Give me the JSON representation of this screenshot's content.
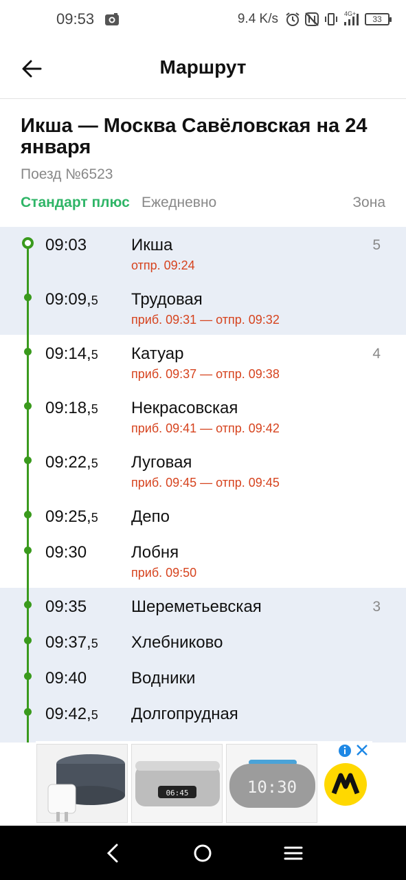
{
  "status_bar": {
    "time": "09:53",
    "net_speed": "9.4 K/s",
    "network": "4G+",
    "battery": "33",
    "icons": [
      "camera-icon",
      "alarm-icon",
      "nfc-off-icon",
      "vibrate-icon",
      "signal-icon",
      "battery-icon"
    ]
  },
  "app_bar": {
    "title": "Маршрут",
    "back_icon": "arrow-left-icon"
  },
  "route": {
    "title": "Икша — Москва Савёловская на 24 января",
    "train": "Поезд №6523",
    "type": "Стандарт плюс",
    "days": "Ежедневно",
    "zone_header": "Зона"
  },
  "colors": {
    "accent_green": "#2fb567",
    "line_green": "#3a9a1d",
    "delay_red": "#d6431e",
    "band_blue": "#e9eef6"
  },
  "stops": [
    {
      "time": "09:03",
      "half": "",
      "name": "Икша",
      "sub": "отпр. 09:24",
      "zone": "5"
    },
    {
      "time": "09:09,",
      "half": "5",
      "name": "Трудовая",
      "sub": "приб. 09:31 — отпр. 09:32",
      "zone": ""
    },
    {
      "time": "09:14,",
      "half": "5",
      "name": "Катуар",
      "sub": "приб. 09:37 — отпр. 09:38",
      "zone": "4"
    },
    {
      "time": "09:18,",
      "half": "5",
      "name": "Некрасовская",
      "sub": "приб. 09:41 — отпр. 09:42",
      "zone": ""
    },
    {
      "time": "09:22,",
      "half": "5",
      "name": "Луговая",
      "sub": "приб. 09:45 — отпр. 09:45",
      "zone": ""
    },
    {
      "time": "09:25,",
      "half": "5",
      "name": "Депо",
      "sub": "",
      "zone": ""
    },
    {
      "time": "09:30",
      "half": "",
      "name": "Лобня",
      "sub": "приб. 09:50",
      "zone": ""
    },
    {
      "time": "09:35",
      "half": "",
      "name": "Шереметьевская",
      "sub": "",
      "zone": "3"
    },
    {
      "time": "09:37,",
      "half": "5",
      "name": "Хлебниково",
      "sub": "",
      "zone": ""
    },
    {
      "time": "09:40",
      "half": "",
      "name": "Водники",
      "sub": "",
      "zone": ""
    },
    {
      "time": "09:42,",
      "half": "5",
      "name": "Долгопрудная",
      "sub": "",
      "zone": ""
    }
  ],
  "ad": {
    "products": [
      "smart-speaker-with-plug",
      "speaker-alarm-clock",
      "smart-clock"
    ],
    "clock_1": "06:45",
    "clock_2": "10:30"
  },
  "nav_bar": {
    "back": "back-icon",
    "home": "home-icon",
    "menu": "menu-icon"
  }
}
